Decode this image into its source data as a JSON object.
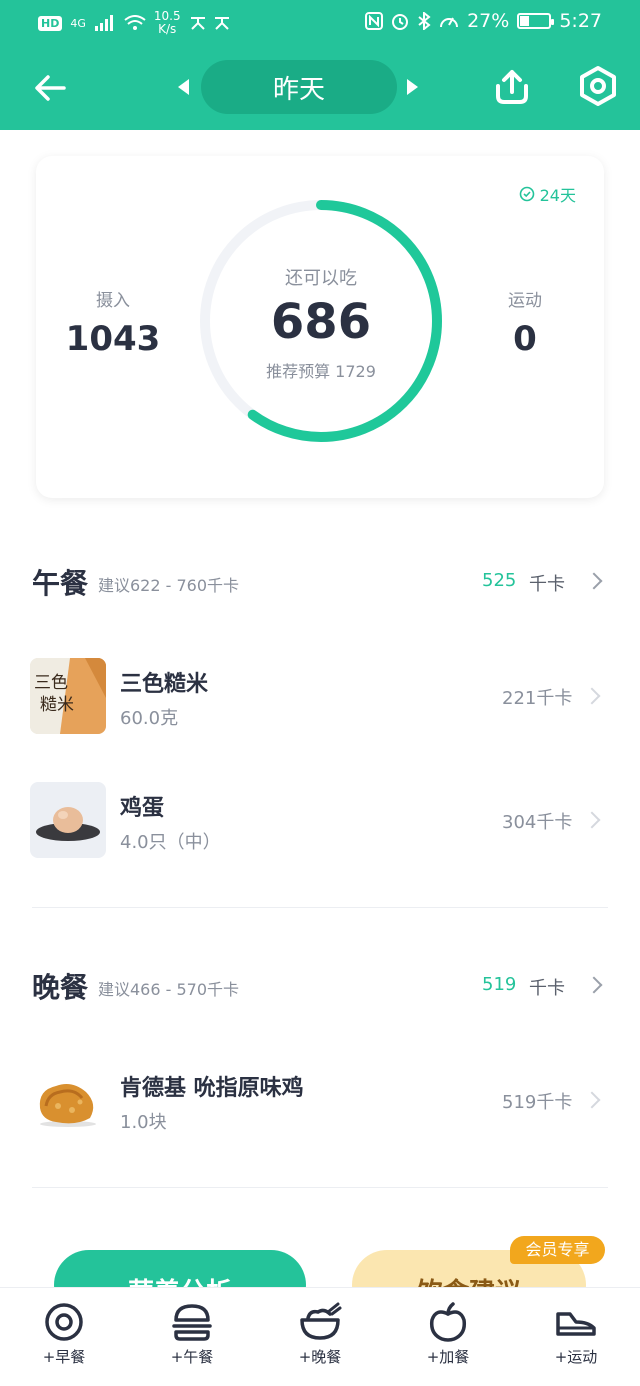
{
  "status_bar": {
    "hd": "HD",
    "network": "4G",
    "speed_value": "10.5",
    "speed_unit": "K/s",
    "battery": "27%",
    "time": "5:27"
  },
  "header": {
    "date_label": "昨天"
  },
  "summary": {
    "streak": "24天",
    "intake_label": "摄入",
    "intake_value": "1043",
    "remaining_label": "还可以吃",
    "remaining_value": "686",
    "budget_label": "推荐预算 1729",
    "exercise_label": "运动",
    "exercise_value": "0",
    "ring_progress": 0.6
  },
  "lunch": {
    "title": "午餐",
    "suggest": "建议622 - 760千卡",
    "kcal": "525",
    "unit": "千卡",
    "items": [
      {
        "name": "三色糙米",
        "qty": "60.0克",
        "kcal": "221千卡"
      },
      {
        "name": "鸡蛋",
        "qty": "4.0只（中）",
        "kcal": "304千卡"
      }
    ]
  },
  "dinner": {
    "title": "晚餐",
    "suggest": "建议466 - 570千卡",
    "kcal": "519",
    "unit": "千卡",
    "items": [
      {
        "name": "肯德基 吮指原味鸡",
        "qty": "1.0块",
        "kcal": "519千卡"
      }
    ]
  },
  "actions": {
    "analysis": "营养分析",
    "advice": "饮食建议",
    "vip_badge": "会员专享"
  },
  "tabbar": [
    {
      "label": "+早餐",
      "icon": "egg-icon"
    },
    {
      "label": "+午餐",
      "icon": "burger-icon"
    },
    {
      "label": "+晚餐",
      "icon": "rice-bowl-icon"
    },
    {
      "label": "+加餐",
      "icon": "apple-icon"
    },
    {
      "label": "+运动",
      "icon": "shoe-icon"
    }
  ],
  "colors": {
    "brand": "#24c39a",
    "pill": "#1aac86",
    "vip": "#f2a71d"
  }
}
